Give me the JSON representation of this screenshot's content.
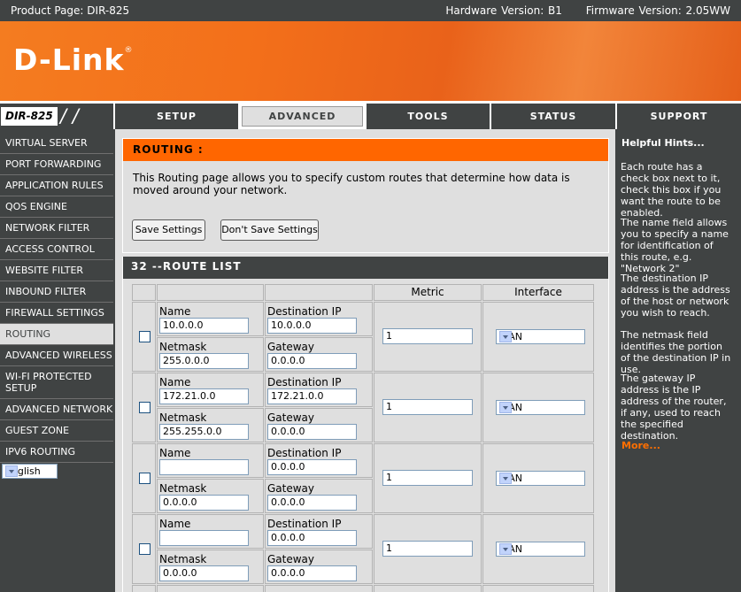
{
  "header": {
    "product_page": "Product Page: DIR-825",
    "hardware_version": "Hardware Version: B1",
    "firmware_version": "Firmware Version: 2.05WW"
  },
  "logo": "D-Link",
  "model": "DIR-825",
  "nav_tabs": [
    "SETUP",
    "ADVANCED",
    "TOOLS",
    "STATUS",
    "SUPPORT"
  ],
  "active_tab": "ADVANCED",
  "sidebar": {
    "items": [
      "VIRTUAL SERVER",
      "PORT FORWARDING",
      "APPLICATION RULES",
      "QOS ENGINE",
      "NETWORK FILTER",
      "ACCESS CONTROL",
      "WEBSITE FILTER",
      "INBOUND FILTER",
      "FIREWALL SETTINGS",
      "ROUTING",
      "ADVANCED WIRELESS",
      "WI-FI PROTECTED SETUP",
      "ADVANCED NETWORK",
      "GUEST ZONE",
      "IPV6 ROUTING"
    ],
    "active": "ROUTING",
    "language": "English"
  },
  "routing": {
    "title": "ROUTING :",
    "description": "This Routing page allows you to specify custom routes that determine how data is moved around your network.",
    "save_label": "Save Settings",
    "dont_save_label": "Don't Save Settings"
  },
  "route_list": {
    "title": "32 --ROUTE LIST",
    "col_metric": "Metric",
    "col_interface": "Interface",
    "label_name": "Name",
    "label_dest": "Destination IP",
    "label_netmask": "Netmask",
    "label_gateway": "Gateway",
    "rows": [
      {
        "name": "10.0.0.0",
        "dest": "10.0.0.0",
        "netmask": "255.0.0.0",
        "gateway": "0.0.0.0",
        "metric": "1",
        "interface": "WAN",
        "enabled": false
      },
      {
        "name": "172.21.0.0",
        "dest": "172.21.0.0",
        "netmask": "255.255.0.0",
        "gateway": "0.0.0.0",
        "metric": "1",
        "interface": "WAN",
        "enabled": false
      },
      {
        "name": "",
        "dest": "0.0.0.0",
        "netmask": "0.0.0.0",
        "gateway": "0.0.0.0",
        "metric": "1",
        "interface": "WAN",
        "enabled": false
      },
      {
        "name": "",
        "dest": "0.0.0.0",
        "netmask": "0.0.0.0",
        "gateway": "0.0.0.0",
        "metric": "1",
        "interface": "WAN",
        "enabled": false
      }
    ]
  },
  "hints": {
    "title": "Helpful Hints...",
    "paragraphs": [
      "Each route has a check box next to it, check this box if you want the route to be enabled.",
      "The name field allows you to specify a name for identification of this route, e.g. \"Network 2\"",
      "The destination IP address is the address of the host or network you wish to reach.",
      "The netmask field identifies the portion of the destination IP in use.",
      "The gateway IP address is the IP address of the router, if any, used to reach the specified destination."
    ],
    "more": "More..."
  }
}
